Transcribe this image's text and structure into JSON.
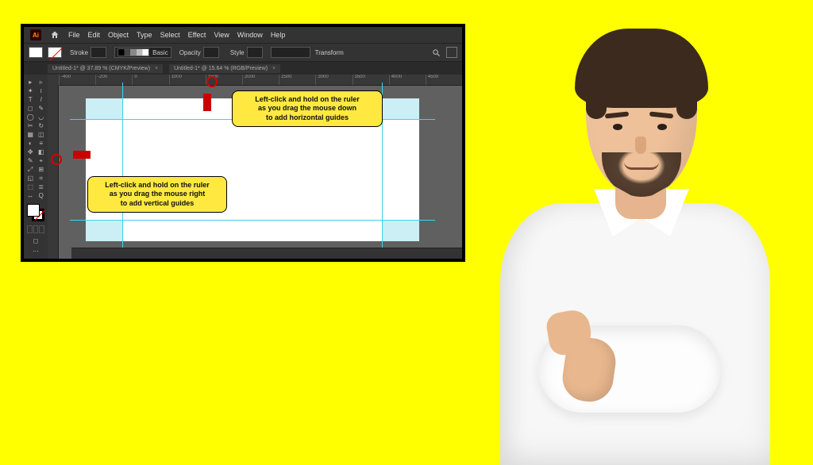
{
  "menu": {
    "items": [
      "File",
      "Edit",
      "Object",
      "Type",
      "Select",
      "Effect",
      "View",
      "Window",
      "Help"
    ]
  },
  "control": {
    "stroke_label": "Stroke",
    "stroke_val": "",
    "basic": "Basic",
    "opacity_label": "Opacity",
    "opacity_val": "",
    "style_label": "Style",
    "transform_label": "Transform"
  },
  "tabs": [
    {
      "label": "Untitled-1* @ 37.89 % (CMYK/Preview)"
    },
    {
      "label": "Untitled-1* @ 15.64 % (RGB/Preview)"
    }
  ],
  "ruler_ticks": [
    "-400",
    "-200",
    "0",
    "1000",
    "1500",
    "2000",
    "2500",
    "3000",
    "3500",
    "4000",
    "4500"
  ],
  "callouts": {
    "top": "Left-click and hold on the ruler\nas you drag the mouse down\nto add horizontal guides",
    "left": "Left-click and hold on the ruler\nas you drag the mouse right\nto add vertical guides"
  },
  "status": "",
  "tool_glyphs": [
    [
      "▸",
      "▹"
    ],
    [
      "✦",
      "≀"
    ],
    [
      "T",
      "/"
    ],
    [
      "◻",
      "✎"
    ],
    [
      "◯",
      "◡"
    ],
    [
      "✂",
      "↻"
    ],
    [
      "▦",
      "◫"
    ],
    [
      "◐",
      "≡"
    ],
    [
      "✥",
      "◧"
    ],
    [
      "✎",
      "⌖"
    ],
    [
      "⤢",
      "⊞"
    ],
    [
      "◱",
      "⌗"
    ],
    [
      "⬚",
      "≣"
    ],
    [
      "↔",
      "Q"
    ]
  ],
  "colors": {
    "callout_bg": "#FFE941",
    "arrow": "#c00000",
    "guide": "#3fd3e8",
    "bleed": "#cceef5"
  }
}
